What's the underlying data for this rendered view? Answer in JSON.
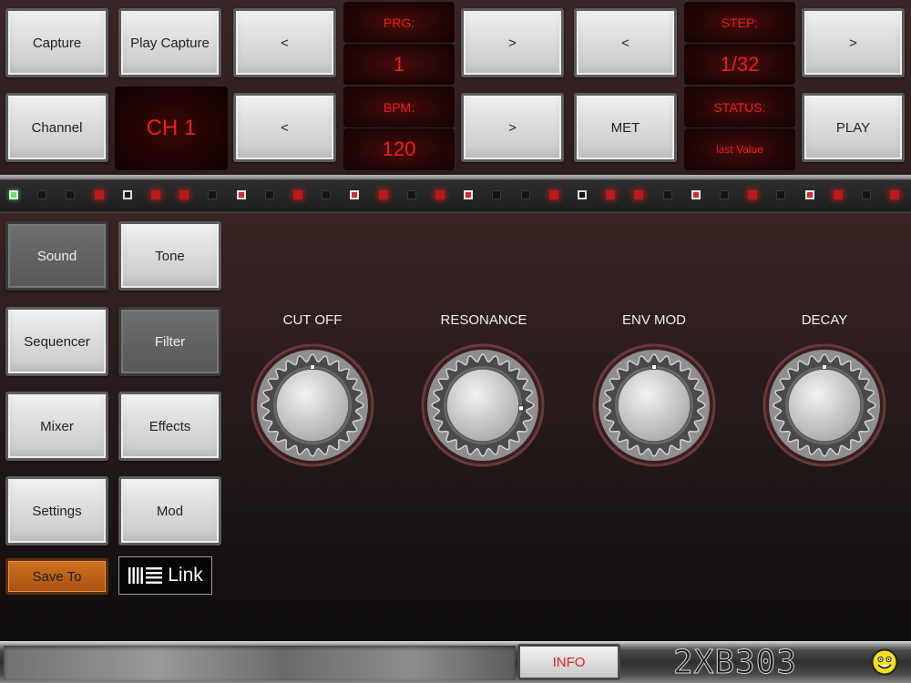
{
  "top": {
    "capture": "Capture",
    "play_capture": "Play Capture",
    "prev1": "<",
    "next1": ">",
    "prev2": "<",
    "next2": ">",
    "channel": "Channel",
    "ch_display": "CH 1",
    "prev3": "<",
    "next3": ">",
    "met": "MET",
    "play": "PLAY",
    "prg_label": "PRG:",
    "prg_value": "1",
    "bpm_label": "BPM:",
    "bpm_value": "120",
    "step_label": "STEP:",
    "step_value": "1/32",
    "status_label": "STATUS:",
    "status_value": "last Value"
  },
  "steps": [
    "green",
    "off",
    "off",
    "red",
    "whiteoff",
    "red",
    "red",
    "off",
    "white",
    "off",
    "red",
    "off",
    "white",
    "red",
    "off",
    "red",
    "white",
    "off",
    "off",
    "red",
    "whiteoff",
    "red",
    "red",
    "off",
    "white",
    "off",
    "red",
    "off",
    "white",
    "red",
    "off",
    "red"
  ],
  "menu": {
    "sound": "Sound",
    "tone": "Tone",
    "sequencer": "Sequencer",
    "filter": "Filter",
    "mixer": "Mixer",
    "effects": "Effects",
    "settings": "Settings",
    "mod": "Mod",
    "save_to": "Save To",
    "link": "Link"
  },
  "knobs": [
    {
      "label": "CUT OFF",
      "value": 0.5
    },
    {
      "label": "RESONANCE",
      "value": 0.85
    },
    {
      "label": "ENV MOD",
      "value": 0.5
    },
    {
      "label": "DECAY",
      "value": 0.5
    }
  ],
  "bottom": {
    "info": "INFO",
    "brand": "2XB303"
  },
  "colors": {
    "display_text": "#e8201c",
    "led_red": "#c01818",
    "led_green": "#6fe06f",
    "save_orange": "#c8661a"
  }
}
